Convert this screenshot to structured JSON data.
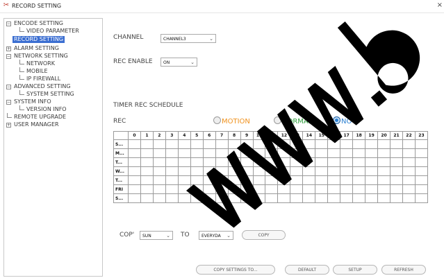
{
  "window": {
    "title": "RECORD SETTING",
    "close_symbol": "×"
  },
  "tree": {
    "items": [
      {
        "label": "ENCODE SETTING",
        "type": "expanded"
      },
      {
        "label": "VIDEO PARAMETER",
        "type": "leaf"
      },
      {
        "label": "RECORD SETTING",
        "type": "selected"
      },
      {
        "label": "ALARM SETTING",
        "type": "collapsed"
      },
      {
        "label": "NETWORK SETTING",
        "type": "expanded"
      },
      {
        "label": "NETWORK",
        "type": "leaf"
      },
      {
        "label": "MOBILE",
        "type": "leaf"
      },
      {
        "label": "IP FIREWALL",
        "type": "leaf"
      },
      {
        "label": "ADVANCED SETTING",
        "type": "expanded"
      },
      {
        "label": "SYSTEM SETTING",
        "type": "leaf"
      },
      {
        "label": "SYSTEM INFO",
        "type": "expanded"
      },
      {
        "label": "VERSION INFO",
        "type": "leaf"
      },
      {
        "label": "REMOTE UPGRADE",
        "type": "leaf"
      },
      {
        "label": "USER MANAGER",
        "type": "collapsed"
      }
    ]
  },
  "form": {
    "channel_label": "CHANNEL",
    "channel_value": "CHANNEL3",
    "rec_enable_label": "REC ENABLE",
    "rec_enable_value": "ON",
    "timer_label": "TIMER REC SCHEDULE",
    "rec_label": "REC",
    "modes": [
      {
        "label": "MOTION",
        "color": "#f0921e",
        "checked": false
      },
      {
        "label": "NORMAL",
        "color": "#2e9e3c",
        "checked": false
      },
      {
        "label": "NO",
        "color": "#2a7fd1",
        "checked": true
      }
    ]
  },
  "schedule": {
    "hours": [
      "0",
      "1",
      "2",
      "3",
      "4",
      "5",
      "6",
      "7",
      "8",
      "9",
      "10",
      "11",
      "12",
      "13",
      "14",
      "15",
      "16",
      "17",
      "18",
      "19",
      "20",
      "21",
      "22",
      "23"
    ],
    "days": [
      "S...",
      "M...",
      "T...",
      "W...",
      "T...",
      "FRI",
      "S..."
    ]
  },
  "copy_row": {
    "copy_label": "COP'",
    "from_value": "SUN",
    "to_label": "TO",
    "to_value": "EVERYDA",
    "copy_button": "COPY"
  },
  "footer": {
    "copy_settings": "COPY SETTINGS TO...",
    "default": "DEFAULT",
    "setup": "SETUP",
    "refresh": "REFRESH"
  }
}
